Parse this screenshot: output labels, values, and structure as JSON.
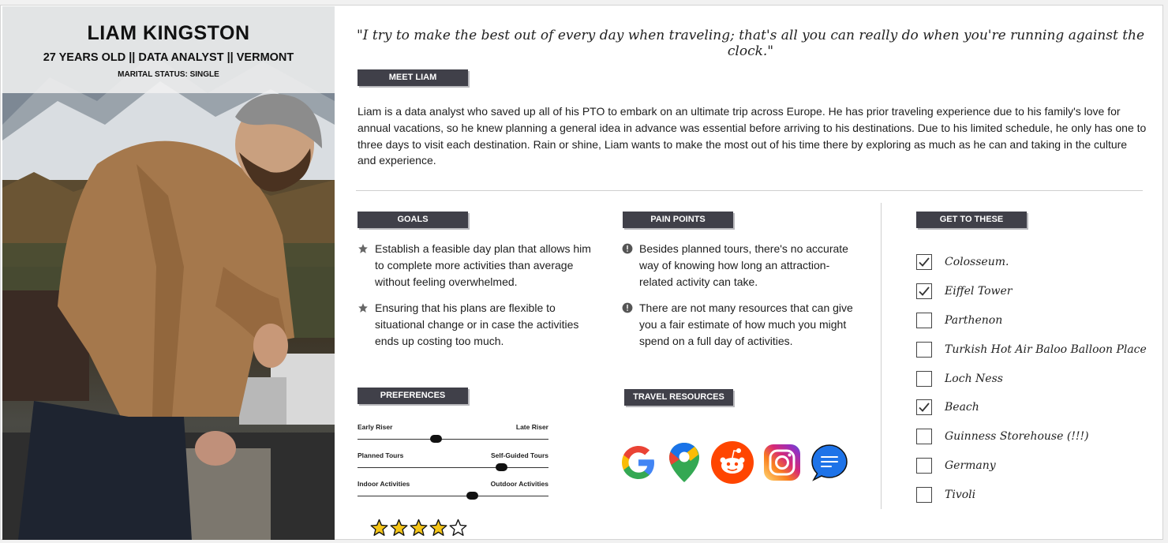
{
  "profile": {
    "name": "LIAM KINGSTON",
    "subtitle": "27 YEARS OLD  || DATA ANALYST || VERMONT",
    "marital_status": "MARITAL STATUS: SINGLE"
  },
  "quote": "\"I try to make the best out of every day when traveling; that's all you can really do when you're running against the clock.\"",
  "meet": {
    "heading": "MEET LIAM",
    "text": "Liam is a data analyst who saved up all of his PTO to embark on an ultimate trip across Europe. He has prior traveling experience due to his family's love for annual vacations, so he knew planning a general idea in advance was essential before arriving to his destinations. Due to his limited schedule, he only has one to three days to visit each destination. Rain or shine, Liam wants to make the most out of his time there by exploring as much as he can and taking in the culture and experience."
  },
  "goals": {
    "heading": "GOALS",
    "items": [
      "Establish a feasible day plan that allows him to complete more activities than average without feeling overwhelmed.",
      "Ensuring that his plans are flexible to situational change or in case the activities ends up costing too much."
    ]
  },
  "pain_points": {
    "heading": "PAIN POINTS",
    "items": [
      "Besides planned tours, there's no accurate way of knowing how long an attraction-related activity can take.",
      "There are not many resources that can give you a fair estimate of how much you might spend on a full day of activities."
    ]
  },
  "preferences": {
    "heading": "PREFERENCES",
    "sliders": [
      {
        "left": "Early Riser",
        "right": "Late Riser",
        "value": 0.41
      },
      {
        "left": "Planned Tours",
        "right": "Self-Guided Tours",
        "value": 0.75
      },
      {
        "left": "Indoor Activities",
        "right": "Outdoor Activities",
        "value": 0.6
      }
    ],
    "rating": 4,
    "rating_max": 5
  },
  "travel_resources": {
    "heading": "TRAVEL RESOURCES",
    "icons": [
      "google-icon",
      "google-maps-icon",
      "reddit-icon",
      "instagram-icon",
      "messages-icon"
    ]
  },
  "get_to_these": {
    "heading": "GET TO THESE",
    "items": [
      {
        "label": "Colosseum.",
        "checked": true
      },
      {
        "label": "Eiffel Tower",
        "checked": true
      },
      {
        "label": "Parthenon",
        "checked": false
      },
      {
        "label": "Turkish Hot Air Baloo Balloon Place",
        "checked": false
      },
      {
        "label": "Loch Ness",
        "checked": false
      },
      {
        "label": "Beach",
        "checked": true
      },
      {
        "label": "Guinness Storehouse (!!!)",
        "checked": false
      },
      {
        "label": "Germany",
        "checked": false
      },
      {
        "label": "Tivoli",
        "checked": false
      }
    ]
  },
  "colors": {
    "tag_bg": "#404049",
    "star": "#f5c518",
    "text": "#1d1d1d"
  }
}
